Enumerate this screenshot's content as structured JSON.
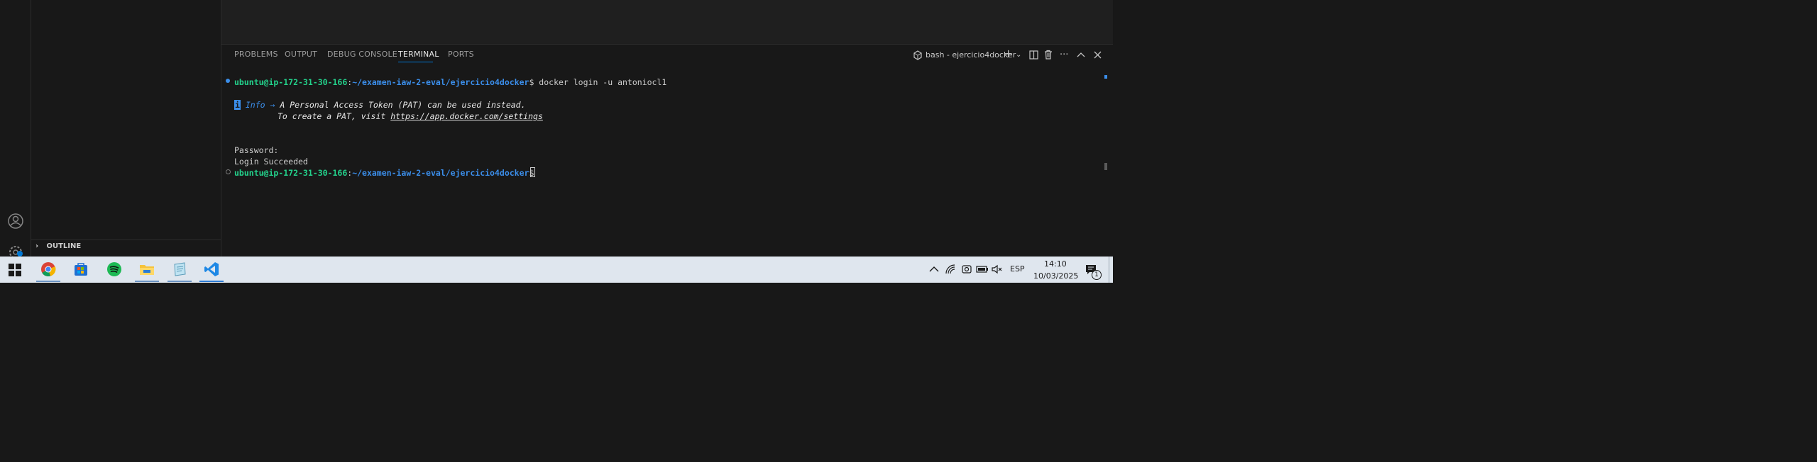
{
  "sidebar": {
    "outline_label": "OUTLINE"
  },
  "panel": {
    "tabs": [
      {
        "label": "PROBLEMS"
      },
      {
        "label": "OUTPUT"
      },
      {
        "label": "DEBUG CONSOLE"
      },
      {
        "label": "TERMINAL"
      },
      {
        "label": "PORTS"
      }
    ],
    "terminal_name": "bash - ejercicio4docker"
  },
  "terminal": {
    "prompt_user": "ubuntu@ip-172-31-30-166",
    "prompt_sep": ":",
    "prompt_path": "~/examen-iaw-2-eval/ejercicio4docker",
    "prompt_dollar": "$ ",
    "command": "docker login -u antoniocl1",
    "info_glyph": "i",
    "info_label": "Info → ",
    "info_text": "A Personal Access Token (PAT) can be used instead.",
    "info_text2": "To create a PAT, visit ",
    "info_link": "https://app.docker.com/settings",
    "password_line": "Password:",
    "login_line": "Login Succeeded"
  },
  "taskbar": {
    "language": "ESP",
    "time": "14:10",
    "date": "10/03/2025",
    "notification_count": "1"
  }
}
